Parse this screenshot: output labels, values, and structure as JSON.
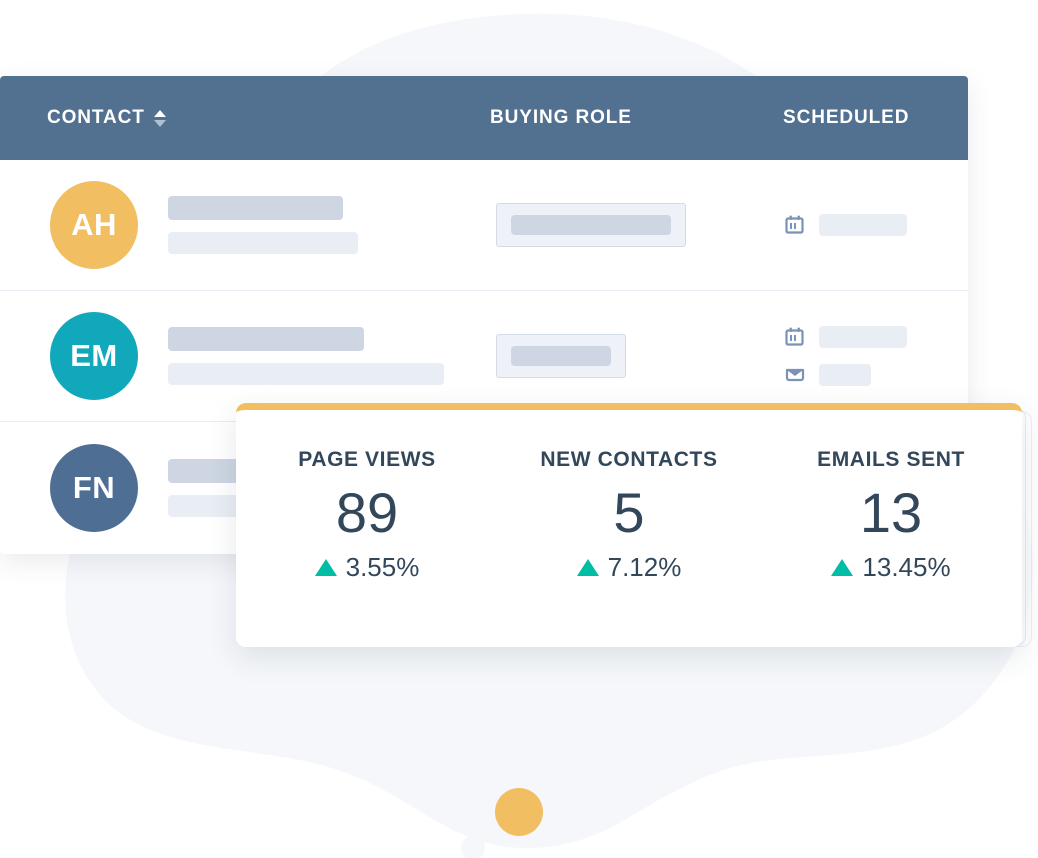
{
  "table": {
    "columns": [
      {
        "key": "contact",
        "label": "CONTACT",
        "sortable": true,
        "sort_icon": "sort-updown-icon"
      },
      {
        "key": "role",
        "label": "BUYING ROLE",
        "sortable": false
      },
      {
        "key": "scheduled",
        "label": "SCHEDULED",
        "sortable": false
      }
    ],
    "header_bg": "#52708F",
    "rows": [
      {
        "avatar_initials": "AH",
        "avatar_color": "#F2BE62",
        "name_bar_widths": [
          175,
          190
        ],
        "role_chip": {
          "width": 190,
          "inner_width": 160
        },
        "scheduled": [
          {
            "icon": "calendar-icon",
            "pill_width": 88
          }
        ]
      },
      {
        "avatar_initials": "EM",
        "avatar_color": "#12A8BC",
        "name_bar_widths": [
          196,
          276
        ],
        "role_chip": {
          "width": 130,
          "inner_width": 100
        },
        "scheduled": [
          {
            "icon": "calendar-icon",
            "pill_width": 88
          },
          {
            "icon": "mail-icon",
            "pill_width": 52
          }
        ]
      },
      {
        "avatar_initials": "FN",
        "avatar_color": "#4F6E94",
        "name_bar_widths": [
          120,
          140
        ],
        "role_chip": null,
        "scheduled": []
      }
    ]
  },
  "stats_card": {
    "accent_color": "#F2BE62",
    "delta_color": "#00BDA5",
    "stats": [
      {
        "label": "PAGE VIEWS",
        "value": "89",
        "delta": "3.55%",
        "direction": "up",
        "direction_icon": "triangle-up-icon"
      },
      {
        "label": "NEW CONTACTS",
        "value": "5",
        "delta": "7.12%",
        "direction": "up",
        "direction_icon": "triangle-up-icon"
      },
      {
        "label": "EMAILS SENT",
        "value": "13",
        "delta": "13.45%",
        "direction": "up",
        "direction_icon": "triangle-up-icon"
      }
    ]
  },
  "decor": {
    "blob_color": "#F5F7FA",
    "dot_color": "#F5F7FA",
    "gold_dot_color": "#F2BE62"
  }
}
